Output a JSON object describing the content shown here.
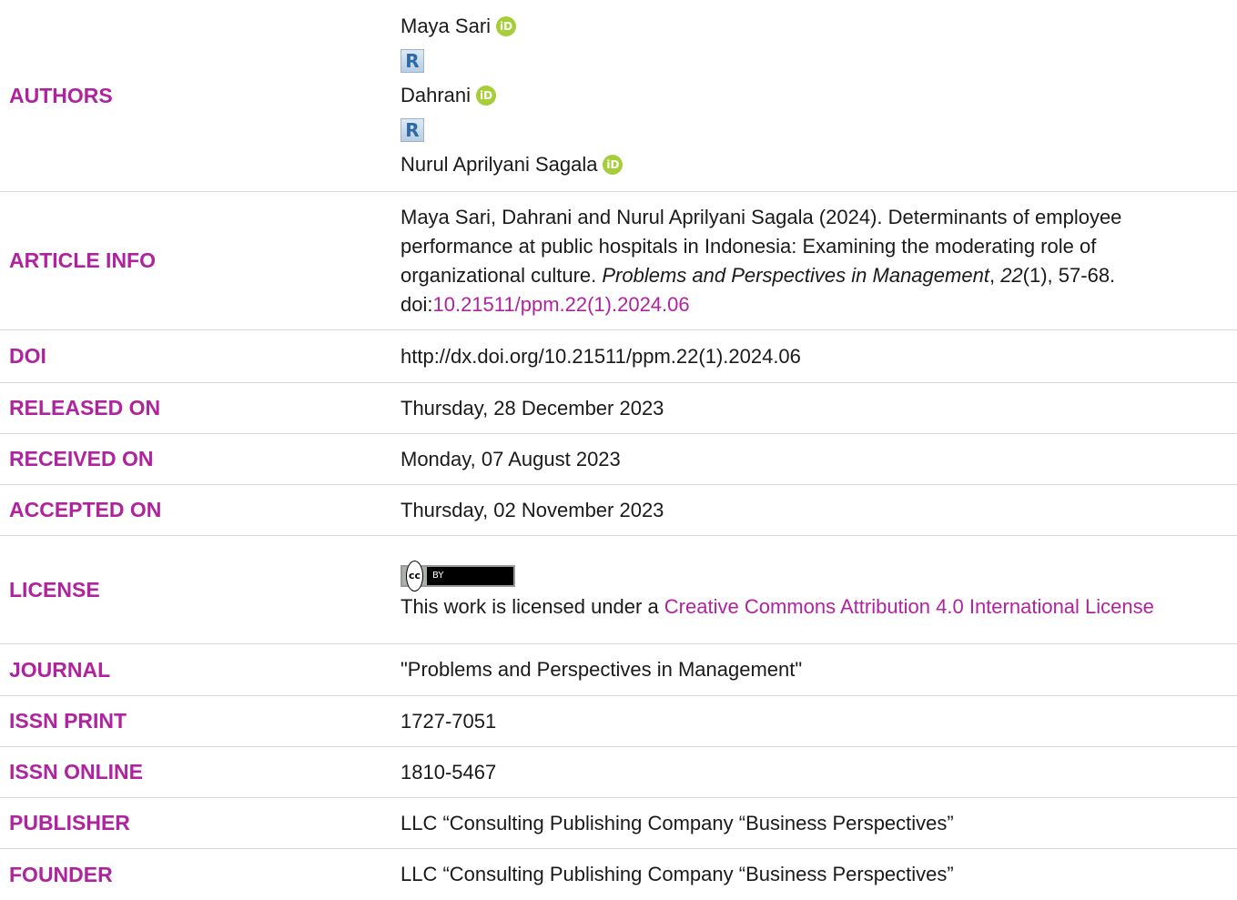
{
  "authors": {
    "label": "AUTHORS",
    "names": [
      "Maya Sari",
      "Dahrani",
      "Nurul Aprilyani Sagala"
    ],
    "orcid_glyph": "iD",
    "researcher_glyph": "R"
  },
  "article_info": {
    "label": "ARTICLE INFO",
    "citation_plain": "Maya Sari, Dahrani and Nurul Aprilyani Sagala (2024). Determinants of employee performance at public hospitals in Indonesia: Examining the moderating role of organizational culture.",
    "journal_name": "Problems and Perspectives in Management",
    "comma": ",",
    "volume": "22",
    "issue_pages": "(1), 57-68. doi:",
    "doi_link": "10.21511/ppm.22(1).2024.06"
  },
  "doi": {
    "label": "DOI",
    "value": "http://dx.doi.org/10.21511/ppm.22(1).2024.06"
  },
  "released": {
    "label": "RELEASED ON",
    "value": "Thursday, 28 December 2023"
  },
  "received": {
    "label": "RECEIVED ON",
    "value": "Monday, 07 August 2023"
  },
  "accepted": {
    "label": "ACCEPTED ON",
    "value": "Thursday, 02 November 2023"
  },
  "license": {
    "label": "LICENSE",
    "badge_cc": "cc",
    "badge_by": "BY",
    "text": "This work is licensed under a ",
    "link": "Creative Commons Attribution 4.0 International License"
  },
  "journal": {
    "label": "JOURNAL",
    "value": "\"Problems and Perspectives in Management\""
  },
  "issn_print": {
    "label": "ISSN PRINT",
    "value": "1727-7051"
  },
  "issn_online": {
    "label": "ISSN ONLINE",
    "value": "1810-5467"
  },
  "publisher": {
    "label": "PUBLISHER",
    "value": "LLC “Consulting Publishing Company “Business Perspectives”"
  },
  "founder": {
    "label": "FOUNDER",
    "value": "LLC “Consulting Publishing Company “Business Perspectives”"
  },
  "colors": {
    "label": "#b0239f",
    "orcid": "#a6ce39",
    "divider": "#d9d9d9"
  }
}
